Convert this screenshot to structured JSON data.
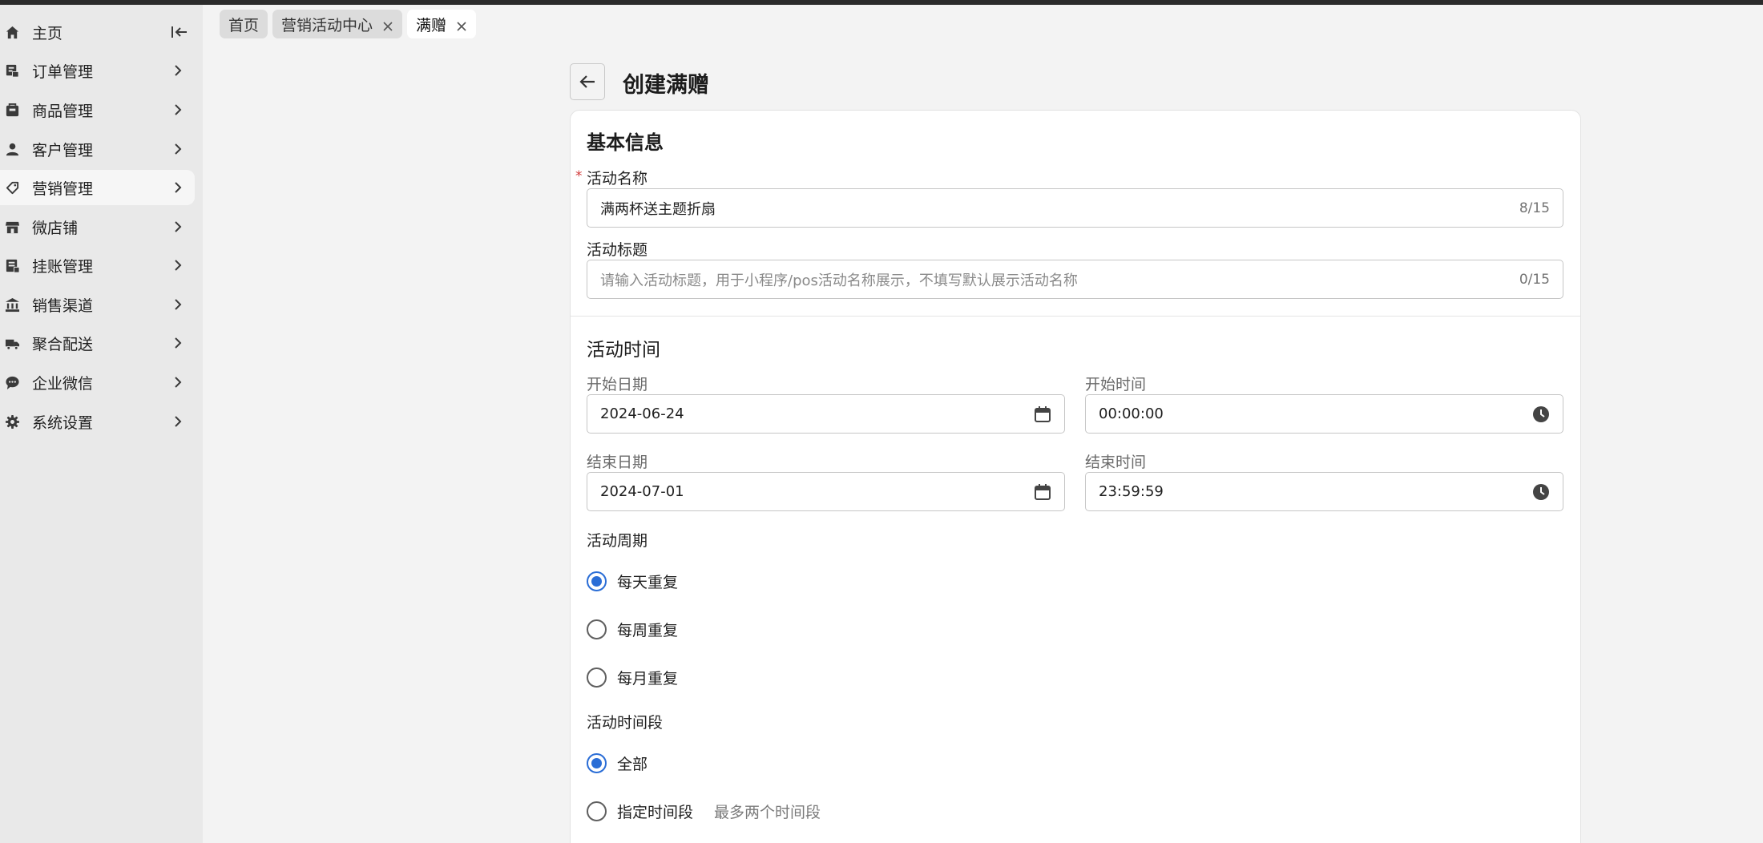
{
  "sidebar": {
    "items": [
      {
        "label": "主页",
        "icon": "home-icon"
      },
      {
        "label": "订单管理",
        "icon": "order-icon"
      },
      {
        "label": "商品管理",
        "icon": "product-icon"
      },
      {
        "label": "客户管理",
        "icon": "customer-icon"
      },
      {
        "label": "营销管理",
        "icon": "tag-icon",
        "active": true
      },
      {
        "label": "微店铺",
        "icon": "store-icon"
      },
      {
        "label": "挂账管理",
        "icon": "credit-icon"
      },
      {
        "label": "销售渠道",
        "icon": "bank-icon"
      },
      {
        "label": "聚合配送",
        "icon": "truck-icon"
      },
      {
        "label": "企业微信",
        "icon": "chat-icon"
      },
      {
        "label": "系统设置",
        "icon": "gear-icon"
      }
    ]
  },
  "tabs": [
    {
      "label": "首页",
      "closable": false
    },
    {
      "label": "营销活动中心",
      "closable": true
    },
    {
      "label": "满赠",
      "closable": true,
      "active": true
    }
  ],
  "page": {
    "title": "创建满赠"
  },
  "basic_info": {
    "title": "基本信息",
    "name_label": "活动名称",
    "name_required": "*",
    "name_value": "满两杯送主题折扇",
    "name_counter": "8/15",
    "title_label": "活动标题",
    "title_placeholder": "请输入活动标题，用于小程序/pos活动名称展示，不填写默认展示活动名称",
    "title_counter": "0/15"
  },
  "activity_time": {
    "title": "活动时间",
    "start_date_label": "开始日期",
    "start_date_value": "2024-06-24",
    "start_time_label": "开始时间",
    "start_time_value": "00:00:00",
    "end_date_label": "结束日期",
    "end_date_value": "2024-07-01",
    "end_time_label": "结束时间",
    "end_time_value": "23:59:59",
    "cycle_label": "活动周期",
    "cycle_options": [
      {
        "label": "每天重复",
        "checked": true
      },
      {
        "label": "每周重复",
        "checked": false
      },
      {
        "label": "每月重复",
        "checked": false
      }
    ],
    "period_label": "活动时间段",
    "period_options": [
      {
        "label": "全部",
        "checked": true
      },
      {
        "label": "指定时间段",
        "checked": false,
        "hint": "最多两个时间段"
      }
    ]
  },
  "colors": {
    "accent": "#2a6dd6",
    "required": "#d23a3a",
    "sidebar_bg": "#e9e9e9",
    "page_bg": "#f3f3f3"
  }
}
